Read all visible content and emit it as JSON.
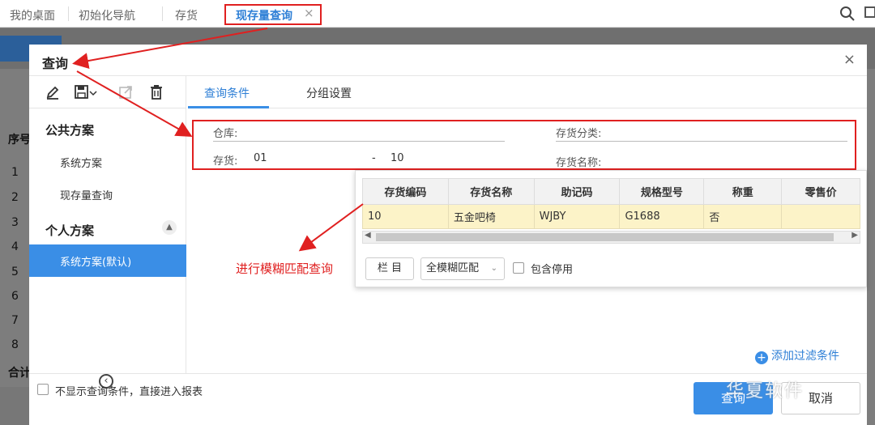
{
  "top_tabs": [
    {
      "label": "我的桌面"
    },
    {
      "label": "初始化导航"
    },
    {
      "label": "存货"
    },
    {
      "label": "现存量查询",
      "close": "×"
    }
  ],
  "background": {
    "header_label": "序号",
    "row_numbers": [
      "1",
      "2",
      "3",
      "4",
      "5",
      "6",
      "7",
      "8"
    ],
    "total_label": "合计"
  },
  "dialog": {
    "title": "查询",
    "close": "×",
    "left_panel": {
      "public_group": "公共方案",
      "public_items": [
        "系统方案",
        "现存量查询"
      ],
      "personal_group": "个人方案",
      "personal_items": [
        "系统方案(默认)"
      ]
    },
    "tabs": [
      "查询条件",
      "分组设置"
    ],
    "fields": {
      "warehouse_label": "仓库:",
      "category_label": "存货分类:",
      "inventory_label": "存货:",
      "inventory_from": "01",
      "range_sep": "-",
      "inventory_to": "10",
      "inventory_name_label": "存货名称:"
    },
    "popup": {
      "columns": [
        "存货编码",
        "存货名称",
        "助记码",
        "规格型号",
        "称重",
        "零售价"
      ],
      "rows": [
        [
          "10",
          "五金吧椅",
          "WJBY",
          "G1688",
          "否",
          ""
        ]
      ],
      "columns_button": "栏 目",
      "match_mode": "全模糊匹配",
      "include_disabled": "包含停用"
    },
    "annotation": "进行模糊匹配查询",
    "add_filter": "添加过滤条件",
    "footer": {
      "skip_label": "不显示查询条件，直接进入报表",
      "query_button": "查询",
      "cancel_button": "取消"
    },
    "watermark": "华夏软件"
  },
  "colors": {
    "accent": "#3a8ee6",
    "highlight": "#e02020",
    "selected_row": "#fcf3c8"
  }
}
